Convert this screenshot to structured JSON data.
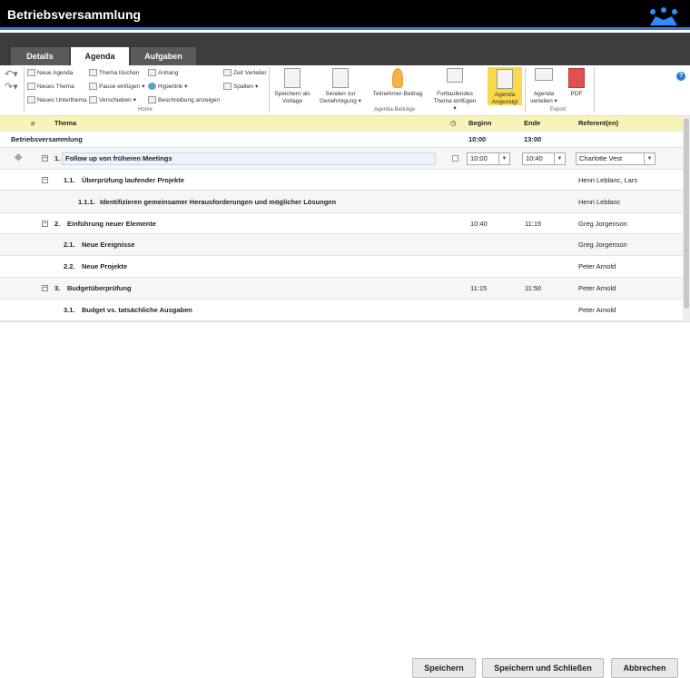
{
  "window": {
    "title": "Betriebsversammlung"
  },
  "tabs": [
    {
      "label": "Details"
    },
    {
      "label": "Agenda"
    },
    {
      "label": "Aufgaben"
    }
  ],
  "ribbon": {
    "home": {
      "group": "Home",
      "items": [
        "Neue Agenda",
        "Neues Thema",
        "Neues Unterthema",
        "Thema löschen",
        "Pause einfügen",
        "Verschieben",
        "Anhang",
        "Hyperlink",
        "Beschreibung anzeigen",
        "Zeit Verteiler",
        "Spalten"
      ]
    },
    "beitraege": {
      "group": "Agenda-Beiträge",
      "items": [
        "Speichern als Vorlage",
        "Senden zur Genehmigung",
        "Teilnehmer-Beitrag",
        "Fortlaufendes Thema einfügen",
        "Agenda Angezeigt"
      ]
    },
    "export": {
      "group": "Export",
      "items": [
        "Agenda verteilen",
        "PDF"
      ]
    },
    "accent": "#f9d84a"
  },
  "table": {
    "headers": {
      "topic": "Thema",
      "begin": "Beginn",
      "end": "Ende",
      "speakers": "Referent(en)"
    },
    "meeting": {
      "title": "Betriebsversammlung",
      "begin": "10:00",
      "end": "13:00"
    },
    "rows": [
      {
        "num": "1.",
        "title": "Follow up von früheren Meetings",
        "begin": "10:00",
        "end": "10:40",
        "speaker": "Charlotte Vest"
      },
      {
        "num": "1.1.",
        "title": "Überprüfung laufender Projekte",
        "begin": "",
        "end": "",
        "speaker": "Henri Leblanc, Lars"
      },
      {
        "num": "1.1.1.",
        "title": "Identifizieren gemeinsamer Herausforderungen und möglicher Lösungen",
        "begin": "",
        "end": "",
        "speaker": "Henri Leblanc"
      },
      {
        "num": "2.",
        "title": "Einführung neuer Elemente",
        "begin": "10:40",
        "end": "11:15",
        "speaker": "Greg Jorgenson"
      },
      {
        "num": "2.1.",
        "title": "Neue Ereignisse",
        "begin": "",
        "end": "",
        "speaker": "Greg Jorgenson"
      },
      {
        "num": "2.2.",
        "title": "Neue Projekte",
        "begin": "",
        "end": "",
        "speaker": "Peter Arnold"
      },
      {
        "num": "3.",
        "title": "Budgetüberprüfung",
        "begin": "11:15",
        "end": "11:50",
        "speaker": "Peter Arnold"
      },
      {
        "num": "3.1.",
        "title": "Budget vs. tatsächliche Ausgaben",
        "begin": "",
        "end": "",
        "speaker": "Peter Arnold"
      }
    ]
  },
  "footer": {
    "save": "Speichern",
    "save_close": "Speichern und Schließen",
    "cancel": "Abbrechen"
  }
}
